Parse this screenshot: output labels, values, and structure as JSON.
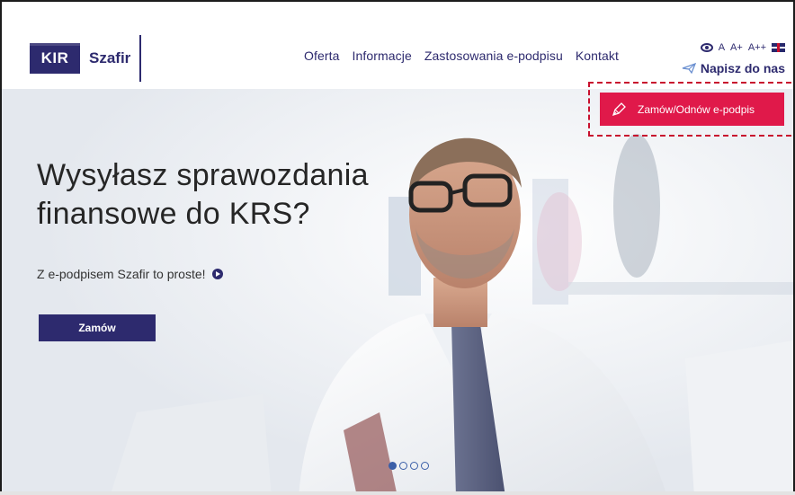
{
  "brand": {
    "kir": "KIR",
    "name": "Szafir"
  },
  "nav": {
    "items": [
      {
        "label": "Oferta"
      },
      {
        "label": "Informacje"
      },
      {
        "label": "Zastosowania e-podpisu"
      },
      {
        "label": "Kontakt"
      }
    ]
  },
  "accessibility": {
    "font_sizes": [
      "A",
      "A+",
      "A++"
    ],
    "contrast_icon": "eye-icon",
    "language_icon": "uk-flag-icon"
  },
  "contact": {
    "label": "Napisz do nas",
    "icon": "paper-plane-icon"
  },
  "order_cta": {
    "label": "Zamów/Odnów e-podpis",
    "icon": "pen-icon",
    "color": "#e0194a"
  },
  "hero": {
    "headline": "Wysyłasz sprawozdania finansowe do KRS?",
    "subtitle": "Z e-podpisem Szafir to proste!",
    "button_label": "Zamów"
  },
  "carousel": {
    "slides": 4,
    "active": 0
  },
  "colors": {
    "brand": "#2d2a6e",
    "accent": "#e0194a",
    "highlight": "#c8102e",
    "dots": "#3b5fa8"
  }
}
